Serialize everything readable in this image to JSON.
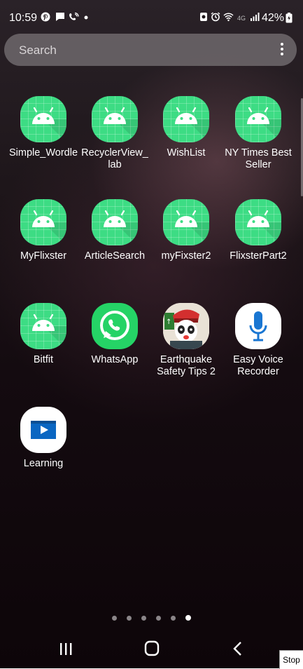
{
  "status_bar": {
    "time": "10:59",
    "battery": "42%"
  },
  "search": {
    "placeholder": "Search"
  },
  "apps": [
    {
      "label": "Simple_Wordle",
      "icon": "android-icon"
    },
    {
      "label": "RecyclerView_\nlab",
      "icon": "android-icon"
    },
    {
      "label": "WishList",
      "icon": "android-icon"
    },
    {
      "label": "NY Times Best\nSeller",
      "icon": "android-icon"
    },
    {
      "label": "MyFlixster",
      "icon": "android-icon"
    },
    {
      "label": "ArticleSearch",
      "icon": "android-icon"
    },
    {
      "label": "myFixster2",
      "icon": "android-icon"
    },
    {
      "label": "FlixsterPart2",
      "icon": "android-icon"
    },
    {
      "label": "Bitfit",
      "icon": "android-icon"
    },
    {
      "label": "WhatsApp",
      "icon": "whatsapp-icon"
    },
    {
      "label": "Earthquake\nSafety Tips 2",
      "icon": "earthquake-panda-icon"
    },
    {
      "label": "Easy Voice\nRecorder",
      "icon": "microphone-icon"
    },
    {
      "label": "Learning",
      "icon": "learning-play-icon"
    }
  ],
  "page_indicator": {
    "pages": 6,
    "active_index": 5
  },
  "nav": {
    "recents_icon": "recents-icon",
    "home_icon": "home-icon",
    "back_icon": "back-icon"
  },
  "overlay": {
    "stop_label": "Stop"
  },
  "colors": {
    "android_green": "#3ddc84",
    "whatsapp_green": "#25d366",
    "mic_blue": "#1976d2"
  }
}
